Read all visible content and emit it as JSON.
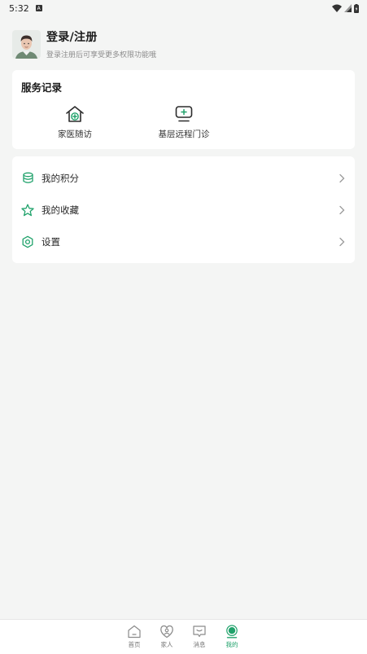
{
  "status_bar": {
    "time": "5:32",
    "badge": "A"
  },
  "profile": {
    "title": "登录/注册",
    "subtitle": "登录注册后可享受更多权限功能哦"
  },
  "service": {
    "title": "服务记录",
    "items": [
      {
        "label": "家医随访",
        "icon": "house-plus-icon"
      },
      {
        "label": "基层远程门诊",
        "icon": "monitor-plus-icon"
      }
    ]
  },
  "menu": {
    "items": [
      {
        "label": "我的积分",
        "icon": "coins-icon"
      },
      {
        "label": "我的收藏",
        "icon": "star-icon"
      },
      {
        "label": "设置",
        "icon": "settings-icon"
      }
    ]
  },
  "tabbar": {
    "tabs": [
      {
        "label": "首页",
        "icon": "home-icon"
      },
      {
        "label": "家人",
        "icon": "family-icon"
      },
      {
        "label": "消息",
        "icon": "message-icon"
      },
      {
        "label": "我的",
        "icon": "profile-icon",
        "active": true
      }
    ]
  },
  "colors": {
    "accent": "#20a26b",
    "background": "#f4f5f4"
  }
}
